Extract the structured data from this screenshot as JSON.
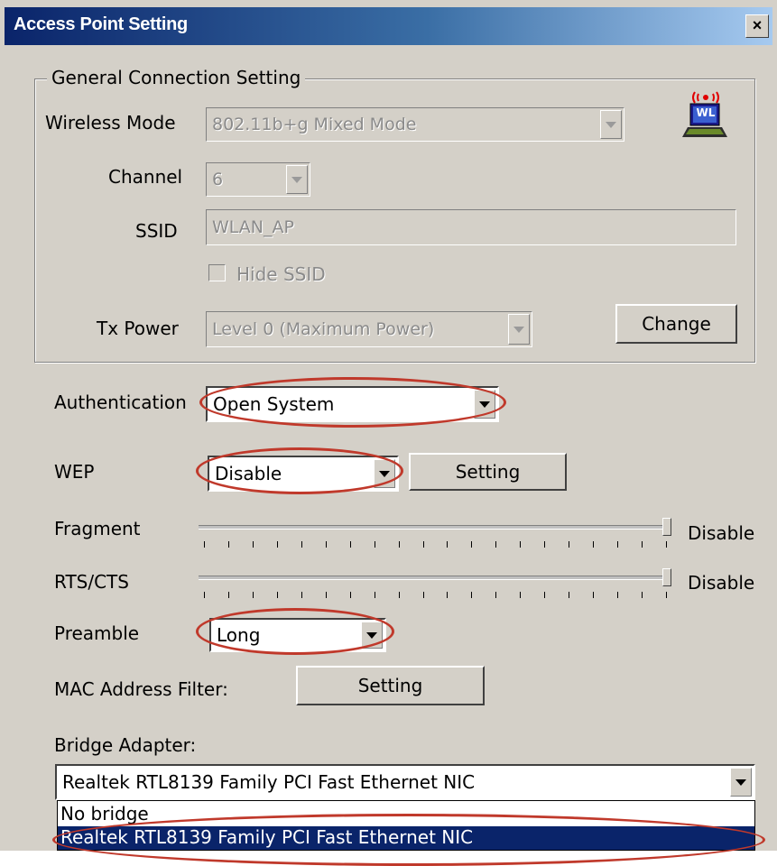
{
  "window": {
    "title": "Access Point Setting",
    "close_glyph": "×"
  },
  "general": {
    "legend": "General Connection Setting",
    "wireless_mode_label": "Wireless Mode",
    "wireless_mode_value": "802.11b+g Mixed Mode",
    "channel_label": "Channel",
    "channel_value": "6",
    "ssid_label": "SSID",
    "ssid_value": "WLAN_AP",
    "hide_ssid_label": "Hide SSID",
    "hide_ssid_checked": false,
    "tx_power_label": "Tx Power",
    "tx_power_value": "Level 0 (Maximum Power)",
    "change_button": "Change",
    "icon_badge": "WL",
    "icon": "wireless-adapter-icon"
  },
  "authentication": {
    "label": "Authentication",
    "value": "Open System"
  },
  "wep": {
    "label": "WEP",
    "value": "Disable",
    "setting_button": "Setting"
  },
  "fragment": {
    "label": "Fragment",
    "value_text": "Disable",
    "level": 1.0
  },
  "rts_cts": {
    "label": "RTS/CTS",
    "value_text": "Disable",
    "level": 1.0
  },
  "preamble": {
    "label": "Preamble",
    "value": "Long"
  },
  "mac_filter": {
    "label": "MAC Address Filter:",
    "setting_button": "Setting"
  },
  "bridge": {
    "label": "Bridge Adapter:",
    "value": "Realtek RTL8139 Family PCI Fast Ethernet NIC",
    "options": [
      "No bridge",
      "Realtek RTL8139 Family PCI Fast Ethernet NIC"
    ],
    "selected_index": 1
  },
  "colors": {
    "highlight_ring": "#c0392b",
    "selection": "#0a246a",
    "dialog": "#d4d0c8"
  }
}
